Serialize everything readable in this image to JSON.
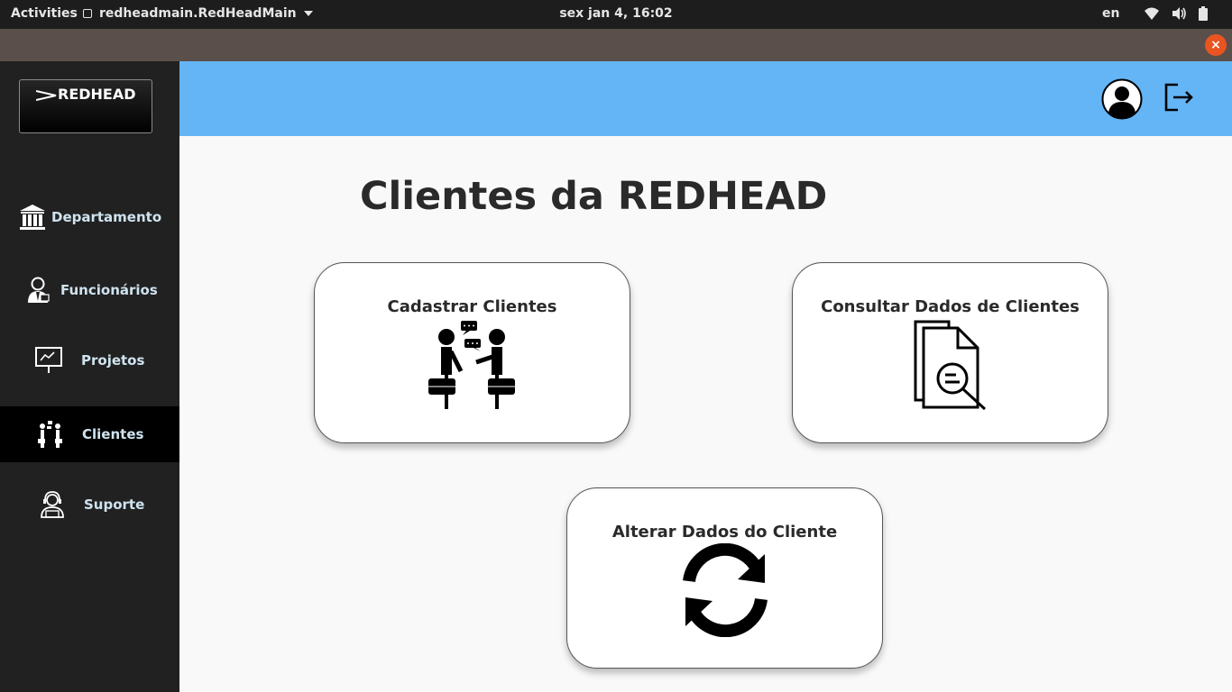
{
  "system_bar": {
    "activities": "Activities",
    "app_name": "redheadmain.RedHeadMain",
    "clock": "sex jan  4, 16:02",
    "language": "en"
  },
  "window": {
    "close_label": "×"
  },
  "sidebar": {
    "logo": "REDHEAD",
    "items": [
      {
        "label": "Departamento",
        "icon": "bank-icon"
      },
      {
        "label": "Funcionários",
        "icon": "employee-icon"
      },
      {
        "label": "Projetos",
        "icon": "presentation-icon"
      },
      {
        "label": "Clientes",
        "icon": "clients-icon",
        "active": true
      },
      {
        "label": "Suporte",
        "icon": "support-icon"
      }
    ]
  },
  "page": {
    "title": "Clientes da REDHEAD",
    "cards": [
      {
        "title": "Cadastrar Clientes",
        "icon": "meeting-icon"
      },
      {
        "title": "Consultar Dados de Clientes",
        "icon": "document-search-icon"
      },
      {
        "title": "Alterar Dados do Cliente",
        "icon": "refresh-icon"
      }
    ]
  },
  "colors": {
    "header": "#64b5f6",
    "sidebar": "#212121",
    "active_item": "#000000",
    "content_bg": "#f9f9f9",
    "close_button": "#e95420"
  }
}
